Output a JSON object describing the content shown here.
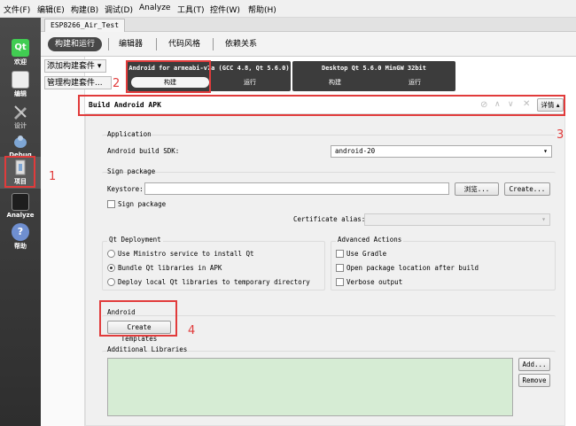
{
  "menu": {
    "file": "文件(F)",
    "edit": "编辑(E)",
    "build": "构建(B)",
    "debug": "调试(D)",
    "analyze": "Analyze",
    "tools": "工具(T)",
    "controls": "控件(W)",
    "help": "帮助(H)"
  },
  "modes": {
    "welcome": "欢迎",
    "edit": "编辑",
    "design": "设计",
    "debug": "Debug",
    "projects": "项目",
    "analyze": "Analyze",
    "help": "帮助"
  },
  "project": {
    "name": "ESP8266_Air_Test"
  },
  "tabs": {
    "build_run": "构建和运行",
    "editor": "编辑器",
    "code_style": "代码风格",
    "dependencies": "依赖关系"
  },
  "left": {
    "add_kit": "添加构建套件 ▾",
    "manage_kits": "管理构建套件..."
  },
  "kits": {
    "android": {
      "title": "Android for armeabi-v7a (GCC 4.8, Qt 5.6.0)",
      "build": "构建",
      "run": "运行"
    },
    "desktop": {
      "title": "Desktop Qt 5.6.0 MinGW 32bit",
      "build": "构建",
      "run": "运行"
    }
  },
  "step": {
    "title": "Build Android APK",
    "details": "详情 ▴"
  },
  "application": {
    "group_title": "Application",
    "sdk_label": "Android build SDK:",
    "sdk_value": "android-20"
  },
  "sign": {
    "group_title": "Sign package",
    "keystore_label": "Keystore:",
    "keystore_value": "",
    "browse": "浏览...",
    "create": "Create...",
    "sign_checkbox": "Sign package",
    "cert_label": "Certificate alias:",
    "cert_value": ""
  },
  "deployment": {
    "group_title": "Qt Deployment",
    "options": [
      "Use Ministro service to install Qt",
      "Bundle Qt libraries in APK",
      "Deploy local Qt libraries to temporary directory"
    ],
    "selected": 1
  },
  "advanced": {
    "group_title": "Advanced Actions",
    "options": [
      "Use Gradle",
      "Open package location after build",
      "Verbose output"
    ]
  },
  "android": {
    "group_title": "Android",
    "create_templates": "Create Templates"
  },
  "libraries": {
    "group_title": "Additional Libraries",
    "add": "Add...",
    "remove": "Remove"
  },
  "annotations": {
    "n1": "1",
    "n2": "2",
    "n3": "3",
    "n4": "4"
  },
  "colors": {
    "annotation_red": "#e13b3b",
    "library_list_bg": "#d6ecd4",
    "qt_green": "#41cd52"
  }
}
